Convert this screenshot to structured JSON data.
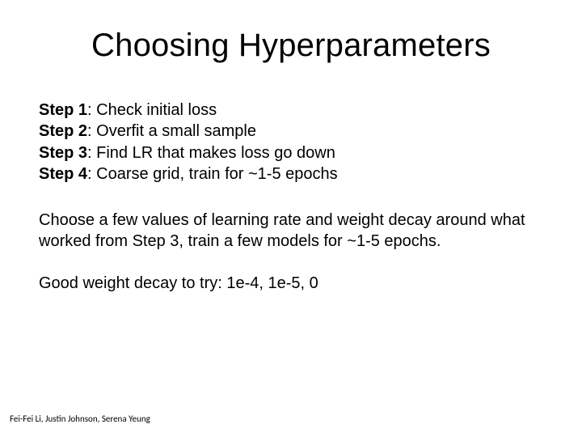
{
  "title": "Choosing Hyperparameters",
  "steps": [
    {
      "label": "Step 1",
      "text": ": Check initial loss"
    },
    {
      "label": "Step 2",
      "text": ": Overfit a small sample"
    },
    {
      "label": "Step 3",
      "text": ": Find LR that makes loss go down"
    },
    {
      "label": "Step 4",
      "text": ": Coarse grid, train for ~1-5 epochs"
    }
  ],
  "paragraphs": [
    "Choose a few values of learning rate and weight decay around what worked from Step 3, train a few models for ~1-5 epochs.",
    "Good weight decay to try: 1e-4, 1e-5, 0"
  ],
  "footer": "Fei-Fei Li, Justin Johnson, Serena Yeung"
}
